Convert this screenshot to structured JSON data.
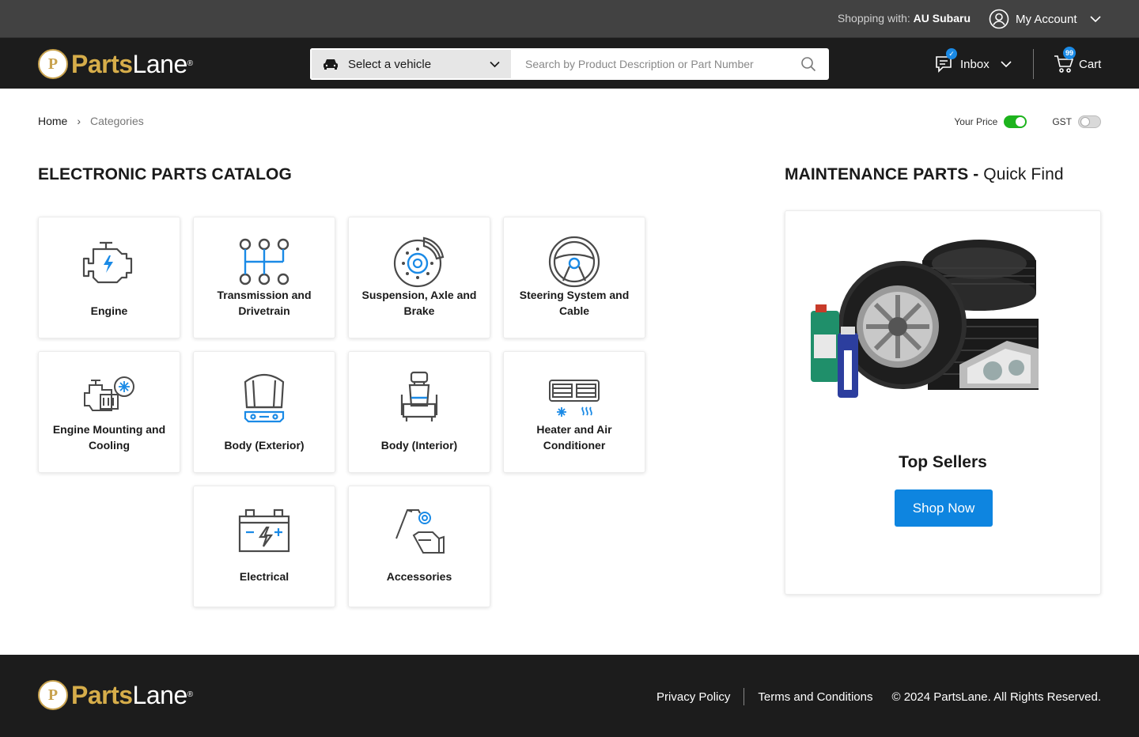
{
  "topbar": {
    "shopping_label": "Shopping with:",
    "dealer": "AU Subaru",
    "account_label": "My Account"
  },
  "brand": {
    "logo_letter": "P",
    "name_part1": "Parts",
    "name_part2": "Lane",
    "reg": "®"
  },
  "header": {
    "vehicle_label": "Select a vehicle",
    "search_placeholder": "Search by Product Description or Part Number",
    "inbox_label": "Inbox",
    "inbox_badge": "✓",
    "cart_label": "Cart",
    "cart_count": "99"
  },
  "breadcrumb": {
    "home": "Home",
    "separator": "›",
    "current": "Categories"
  },
  "price_toggles": {
    "your_price_label": "Your Price",
    "your_price_on": true,
    "gst_label": "GST",
    "gst_on": false
  },
  "catalog": {
    "title": "ELECTRONIC PARTS CATALOG",
    "categories": [
      {
        "label": "Engine",
        "icon": "engine-icon"
      },
      {
        "label": "Transmission and Drivetrain",
        "icon": "gear-shift-icon"
      },
      {
        "label": "Suspension, Axle and Brake",
        "icon": "brake-disc-icon"
      },
      {
        "label": "Steering System and Cable",
        "icon": "steering-wheel-icon"
      },
      {
        "label": "Engine Mounting and Cooling",
        "icon": "engine-cooling-icon"
      },
      {
        "label": "Body (Exterior)",
        "icon": "car-hood-icon"
      },
      {
        "label": "Body (Interior)",
        "icon": "car-seat-icon"
      },
      {
        "label": "Heater and Air Conditioner",
        "icon": "air-vent-icon"
      },
      {
        "label": "Electrical",
        "icon": "battery-icon"
      },
      {
        "label": "Accessories",
        "icon": "mirror-icon"
      }
    ]
  },
  "maintenance": {
    "title_bold": "MAINTENANCE PARTS -",
    "title_light": "Quick Find",
    "card_title": "Top Sellers",
    "button_label": "Shop Now"
  },
  "footer": {
    "privacy": "Privacy Policy",
    "terms": "Terms and Conditions",
    "copyright": "© 2024 PartsLane. All Rights Reserved."
  },
  "colors": {
    "accent_blue": "#0e85e0",
    "gold": "#d6ad4a",
    "toggle_on": "#1db31d",
    "dark": "#1c1c1c"
  }
}
